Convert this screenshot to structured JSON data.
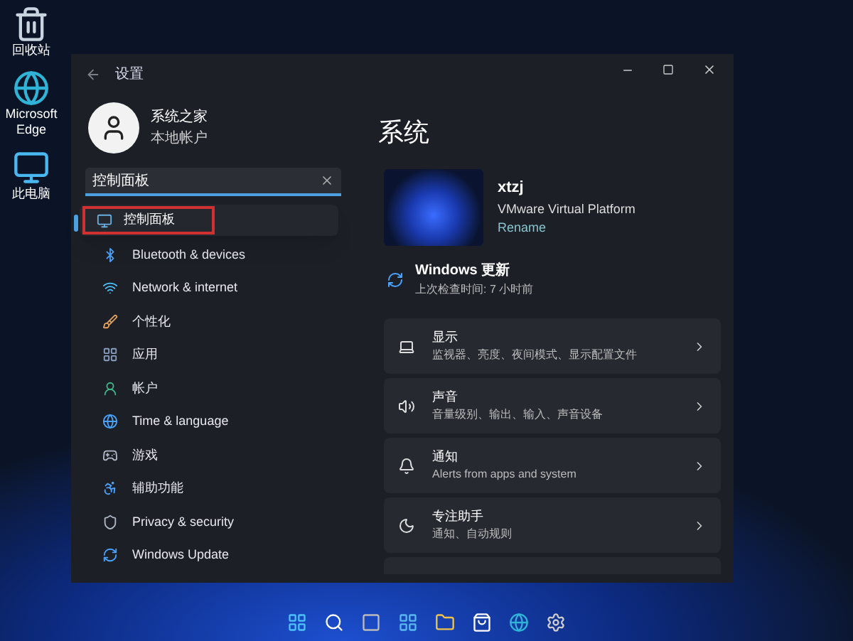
{
  "desktop_icons": [
    {
      "label": "回收站"
    },
    {
      "label": "Microsoft Edge"
    },
    {
      "label": "此电脑"
    }
  ],
  "window": {
    "title": "设置"
  },
  "account": {
    "name": "系统之家",
    "type": "本地帐户"
  },
  "search": {
    "value": "控制面板",
    "results": [
      {
        "label": "控制面板",
        "selected": true
      }
    ]
  },
  "sidebar": {
    "items": [
      {
        "label": "Bluetooth & devices",
        "selected": false
      },
      {
        "label": "Network & internet",
        "selected": false
      },
      {
        "label": "个性化",
        "selected": false
      },
      {
        "label": "应用",
        "selected": false
      },
      {
        "label": "帐户",
        "selected": false
      },
      {
        "label": "Time & language",
        "selected": false
      },
      {
        "label": "游戏",
        "selected": false
      },
      {
        "label": "辅助功能",
        "selected": false
      },
      {
        "label": "Privacy & security",
        "selected": false
      },
      {
        "label": "Windows Update",
        "selected": false
      }
    ]
  },
  "page": {
    "title": "系统",
    "device": {
      "name": "xtzj",
      "model": "VMware Virtual Platform",
      "rename": "Rename"
    },
    "update": {
      "title": "Windows 更新",
      "subtitle": "上次检查时间: 7 小时前"
    },
    "cards": [
      {
        "title": "显示",
        "subtitle": "监视器、亮度、夜间模式、显示配置文件"
      },
      {
        "title": "声音",
        "subtitle": "音量级别、输出、输入、声音设备"
      },
      {
        "title": "通知",
        "subtitle": "Alerts from apps and system"
      },
      {
        "title": "专注助手",
        "subtitle": "通知、自动规则"
      }
    ]
  }
}
